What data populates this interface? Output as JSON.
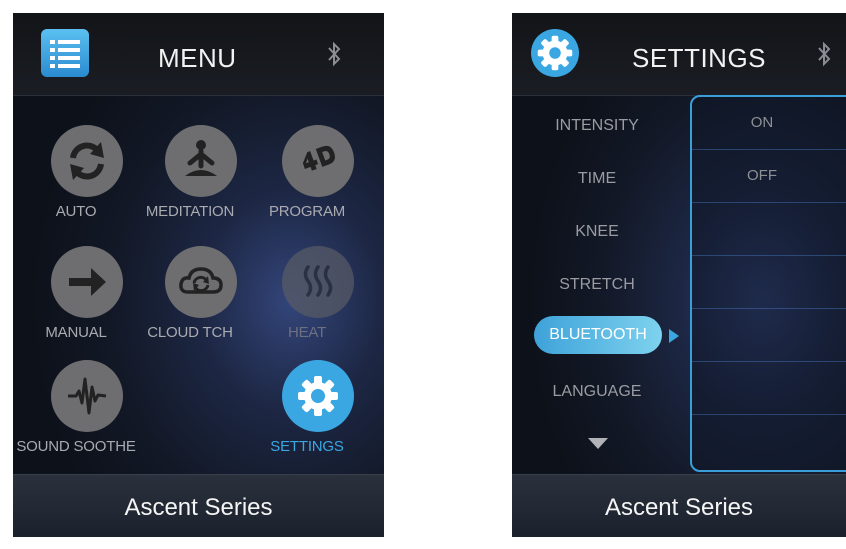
{
  "menu_screen": {
    "title": "MENU",
    "footer": "Ascent Series",
    "tiles": [
      {
        "label": "AUTO",
        "icon": "auto-refresh-icon"
      },
      {
        "label": "MEDITATION",
        "icon": "meditation-icon"
      },
      {
        "label": "PROGRAM",
        "icon": "4d-program-icon"
      },
      {
        "label": "MANUAL",
        "icon": "arrow-right-icon"
      },
      {
        "label": "CLOUD TCH",
        "icon": "cloud-sync-icon"
      },
      {
        "label": "HEAT",
        "icon": "heat-icon"
      },
      {
        "label": "SOUND SOOTHE",
        "icon": "soundwave-icon"
      },
      {
        "label": "SETTINGS",
        "icon": "gear-icon"
      }
    ]
  },
  "settings_screen": {
    "title": "SETTINGS",
    "footer": "Ascent Series",
    "items": [
      "INTENSITY",
      "TIME",
      "KNEE",
      "STRETCH",
      "BLUETOOTH",
      "LANGUAGE"
    ],
    "selected_item": "BLUETOOTH",
    "options": [
      "ON",
      "OFF"
    ]
  },
  "colors": {
    "accent": "#3aa7e3",
    "icon_gray": "#6e6e70",
    "text_gray": "#a9abb0"
  }
}
